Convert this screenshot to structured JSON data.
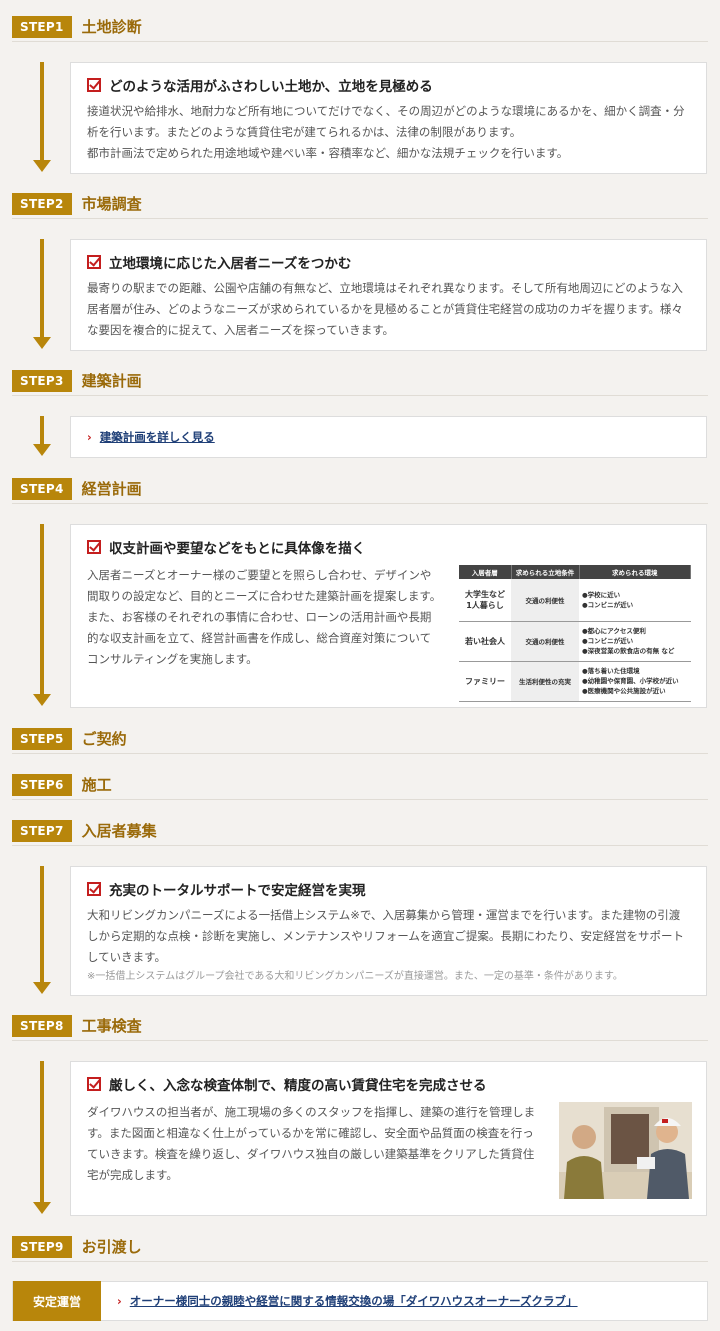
{
  "steps": [
    {
      "badge": "STEP1",
      "title": "土地診断"
    },
    {
      "badge": "STEP2",
      "title": "市場調査"
    },
    {
      "badge": "STEP3",
      "title": "建築計画"
    },
    {
      "badge": "STEP4",
      "title": "経営計画"
    },
    {
      "badge": "STEP5",
      "title": "ご契約"
    },
    {
      "badge": "STEP6",
      "title": "施工"
    },
    {
      "badge": "STEP7",
      "title": "入居者募集"
    },
    {
      "badge": "STEP8",
      "title": "工事検査"
    },
    {
      "badge": "STEP9",
      "title": "お引渡し"
    }
  ],
  "cards": {
    "step1": {
      "heading": "どのような活用がふさわしい土地か、立地を見極める",
      "body1": "接道状況や給排水、地耐力など所有地についてだけでなく、その周辺がどのような環境にあるかを、細かく調査・分析を行います。またどのような賃貸住宅が建てられるかは、法律の制限があります。",
      "body2": "都市計画法で定められた用途地域や建ぺい率・容積率など、細かな法規チェックを行います。"
    },
    "step2": {
      "heading": "立地環境に応じた入居者ニーズをつかむ",
      "body": "最寄りの駅までの距離、公園や店舗の有無など、立地環境はそれぞれ異なります。そして所有地周辺にどのような入居者層が住み、どのようなニーズが求められているかを見極めることが賃貸住宅経営の成功のカギを握ります。様々な要因を複合的に捉えて、入居者ニーズを探っていきます。"
    },
    "step3": {
      "link": "建築計画を詳しく見る"
    },
    "step4": {
      "heading": "収支計画や要望などをもとに具体像を描く",
      "body": "入居者ニーズとオーナー様のご要望とを照らし合わせ、デザインや間取りの設定など、目的とニーズに合わせた建築計画を提案します。また、お客様のそれぞれの事情に合わせ、ローンの活用計画や長期的な収支計画を立て、経営計画書を作成し、総合資産対策についてコンサルティングを実施します。",
      "table": {
        "headers": [
          "入居者層",
          "求められる立地条件",
          "求められる環境"
        ],
        "rows": [
          {
            "layer": "大学生など\n1人暮らし",
            "cond": "交通の利便性",
            "env": "●学校に近い\n●コンビニが近い"
          },
          {
            "layer": "若い社会人",
            "cond": "交通の利便性",
            "env": "●都心にアクセス便利\n●コンビニが近い\n●深夜営業の飲食店の有無 など"
          },
          {
            "layer": "ファミリー",
            "cond": "生活利便性の充実",
            "env": "●落ち着いた住環境\n●幼稚園や保育園、小学校が近い\n●医療機関や公共施設が近い"
          }
        ]
      }
    },
    "step7": {
      "heading": "充実のトータルサポートで安定経営を実現",
      "body": "大和リビングカンパニーズによる一括借上システム※で、入居募集から管理・運営までを行います。また建物の引渡しから定期的な点検・診断を実施し、メンテナンスやリフォームを適宜ご提案。長期にわたり、安定経営をサポートしていきます。",
      "note": "※一括借上システムはグループ会社である大和リビングカンパニーズが直接運営。また、一定の基準・条件があります。"
    },
    "step8": {
      "heading": "厳しく、入念な検査体制で、精度の高い賃貸住宅を完成させる",
      "body": "ダイワハウスの担当者が、施工現場の多くのスタッフを指揮し、建築の進行を管理します。また図面と相違なく仕上がっているかを常に確認し、安全面や品質面の検査を行っていきます。検査を繰り返し、ダイワハウス独自の厳しい建築基準をクリアした賃貸住宅が完成します。"
    }
  },
  "footer": {
    "badge": "安定運営",
    "link": "オーナー様同士の親睦や経営に関する情報交換の場「ダイワハウスオーナーズクラブ」"
  },
  "colors": {
    "accent": "#b8860b",
    "check": "#c41e1e",
    "link": "#1f3f77"
  }
}
